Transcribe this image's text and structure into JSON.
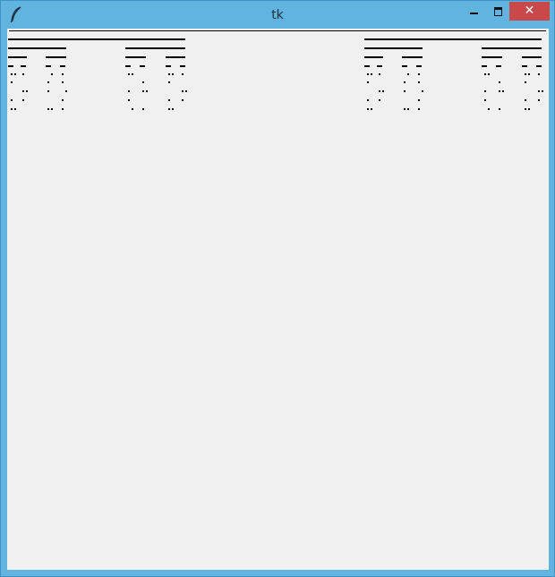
{
  "window": {
    "title": "tk",
    "close_glyph": "✕",
    "icon": "feather-icon",
    "colors": {
      "frame": "#62b4e0",
      "close": "#c9484a",
      "client": "#f0f0f0"
    }
  }
}
